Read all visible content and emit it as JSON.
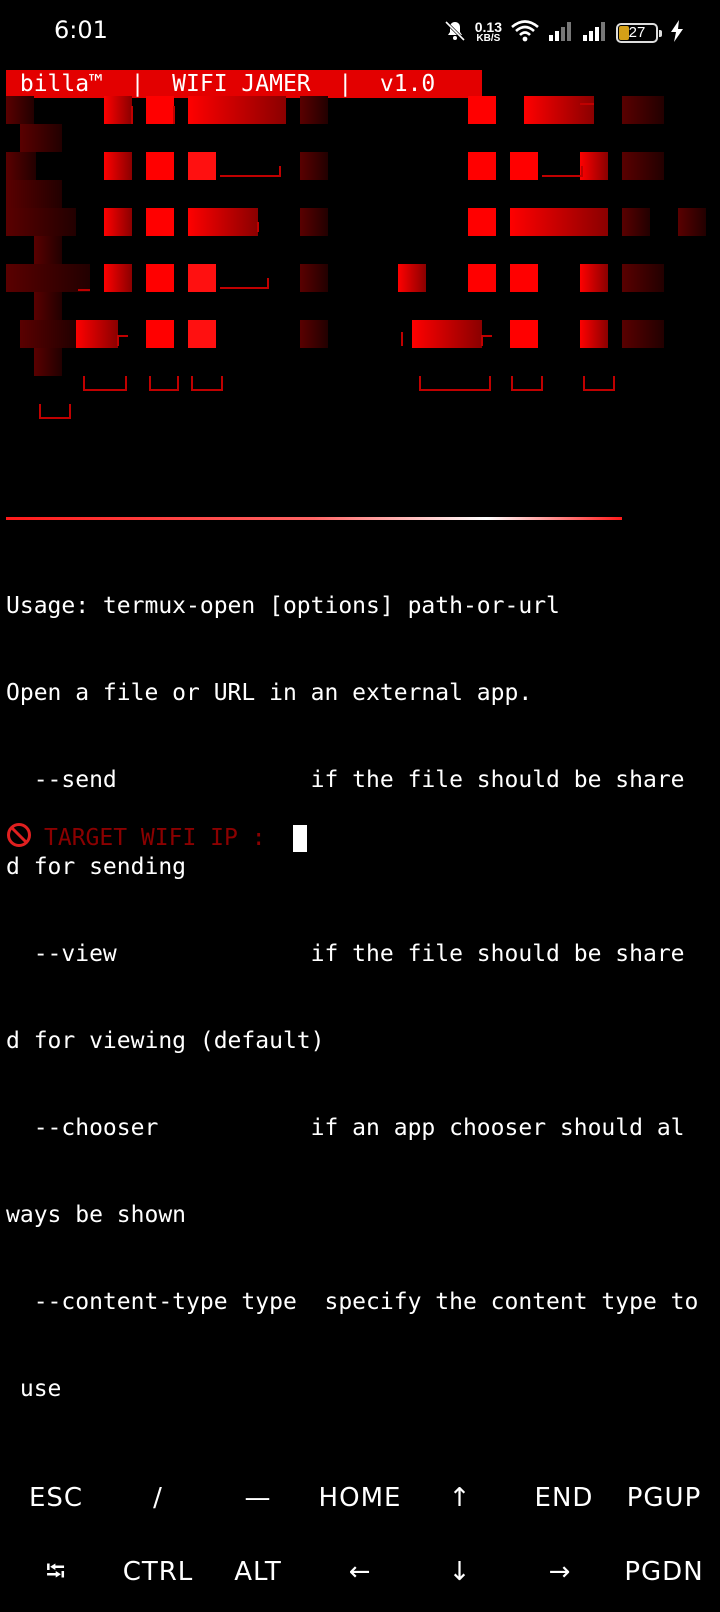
{
  "status_bar": {
    "time": "6:01",
    "network_speed": "0.13",
    "network_speed_unit": "KB/S",
    "battery_level": "27",
    "icons": [
      "bell-muted-icon",
      "wifi-icon",
      "signal-icon",
      "signal-icon",
      "battery-icon",
      "charging-icon"
    ]
  },
  "banner": {
    "title": " billa™  |  WIFI JAMER  |  v1.0",
    "colors": {
      "banner_bg": "#e30000",
      "art_red": "#ff0000",
      "art_dark": "#7a0000"
    }
  },
  "terminal": {
    "lines": [
      "Usage: termux-open [options] path-or-url",
      "Open a file or URL in an external app.",
      "  --send              if the file should be share",
      "d for sending",
      "  --view              if the file should be share",
      "d for viewing (default)",
      "  --chooser           if an app chooser should al",
      "ways be shown",
      "  --content-type type  specify the content type to",
      " use"
    ],
    "prompt_icon": "🚫",
    "prompt_label": "TARGET WIFI IP : "
  },
  "extra_keys": {
    "row1": [
      "ESC",
      "/",
      "—",
      "HOME",
      "↑",
      "END",
      "PGUP"
    ],
    "row2": [
      "⭾",
      "CTRL",
      "ALT",
      "←",
      "↓",
      "→",
      "PGDN"
    ]
  }
}
